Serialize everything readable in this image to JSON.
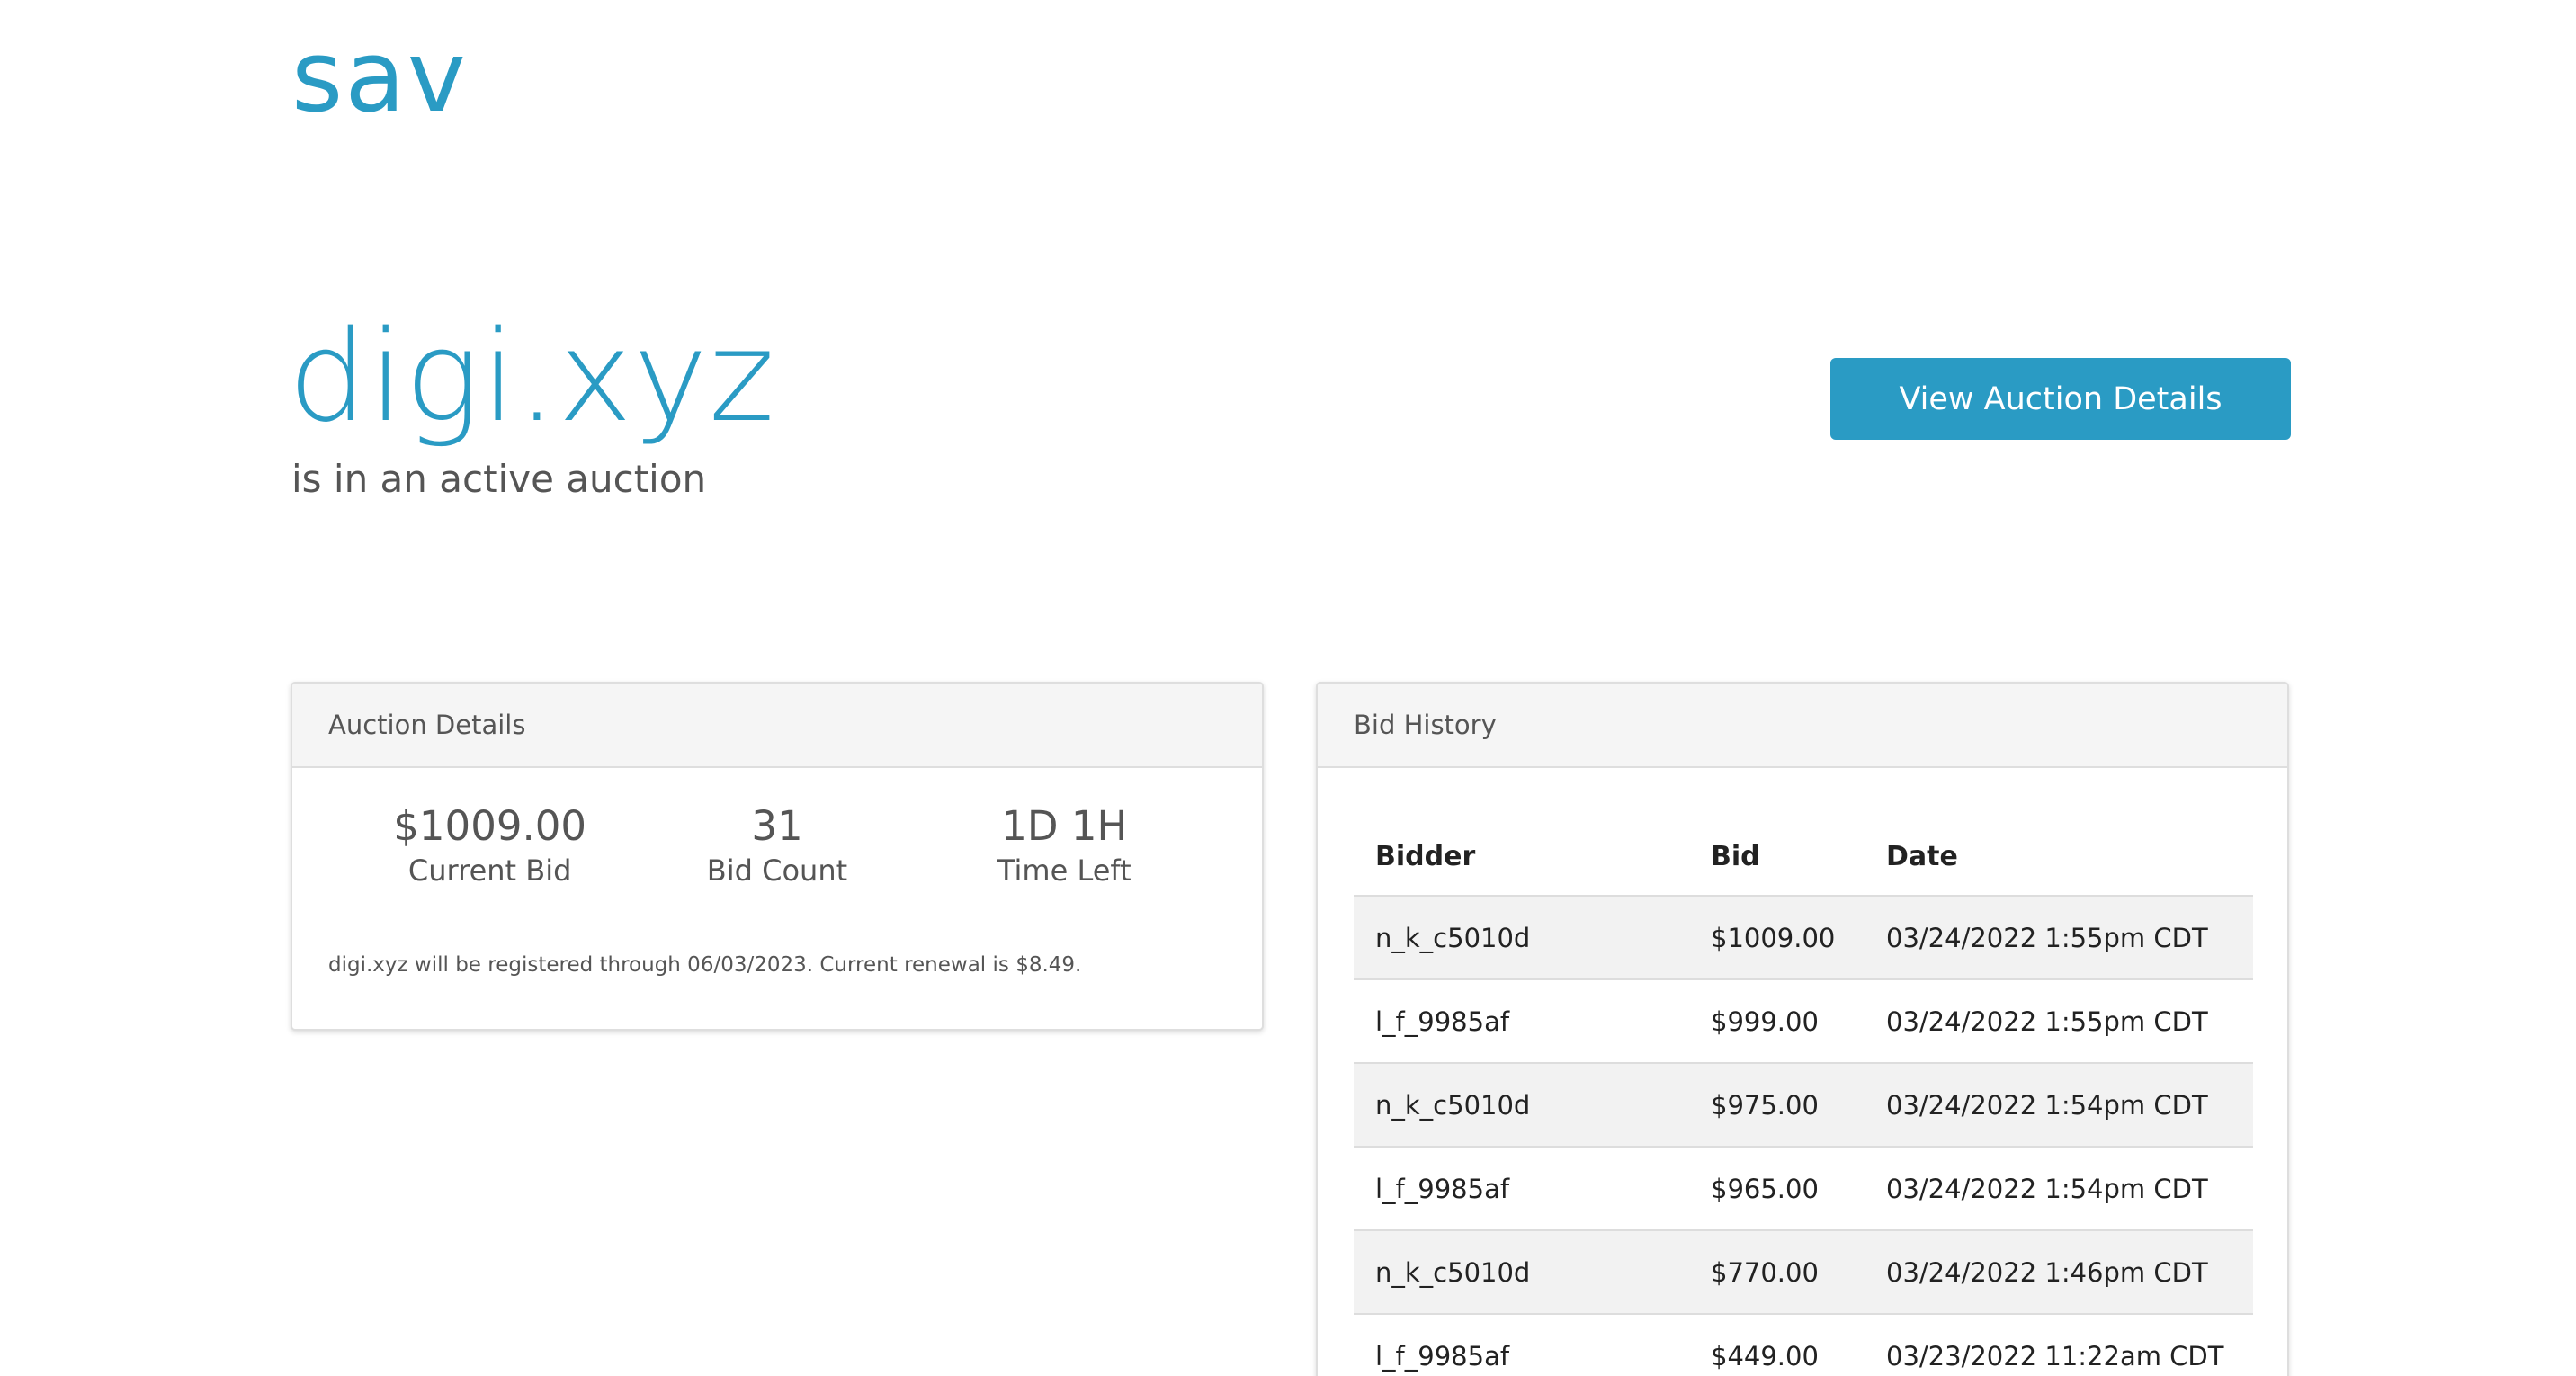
{
  "header": {
    "logo_text": "sav"
  },
  "hero": {
    "domain": "digi.xyz",
    "status_text": "is in an active auction",
    "cta_label": "View Auction Details"
  },
  "auction_details": {
    "title": "Auction Details",
    "current_bid": {
      "value": "$1009.00",
      "label": "Current Bid"
    },
    "bid_count": {
      "value": "31",
      "label": "Bid Count"
    },
    "time_left": {
      "value": "1D 1H",
      "label": "Time Left"
    },
    "renewal_note": "digi.xyz will be registered through 06/03/2023. Current renewal is $8.49."
  },
  "bid_history": {
    "title": "Bid History",
    "columns": [
      "Bidder",
      "Bid",
      "Date"
    ],
    "rows": [
      [
        "n_k_c5010d",
        "$1009.00",
        "03/24/2022 1:55pm CDT"
      ],
      [
        "l_f_9985af",
        "$999.00",
        "03/24/2022 1:55pm CDT"
      ],
      [
        "n_k_c5010d",
        "$975.00",
        "03/24/2022 1:54pm CDT"
      ],
      [
        "l_f_9985af",
        "$965.00",
        "03/24/2022 1:54pm CDT"
      ],
      [
        "n_k_c5010d",
        "$770.00",
        "03/24/2022 1:46pm CDT"
      ],
      [
        "l_f_9985af",
        "$449.00",
        "03/23/2022 11:22am CDT"
      ]
    ]
  },
  "colors": {
    "brand": "#2a9bc4",
    "text": "#555555",
    "row_stripe": "#f2f2f2"
  }
}
